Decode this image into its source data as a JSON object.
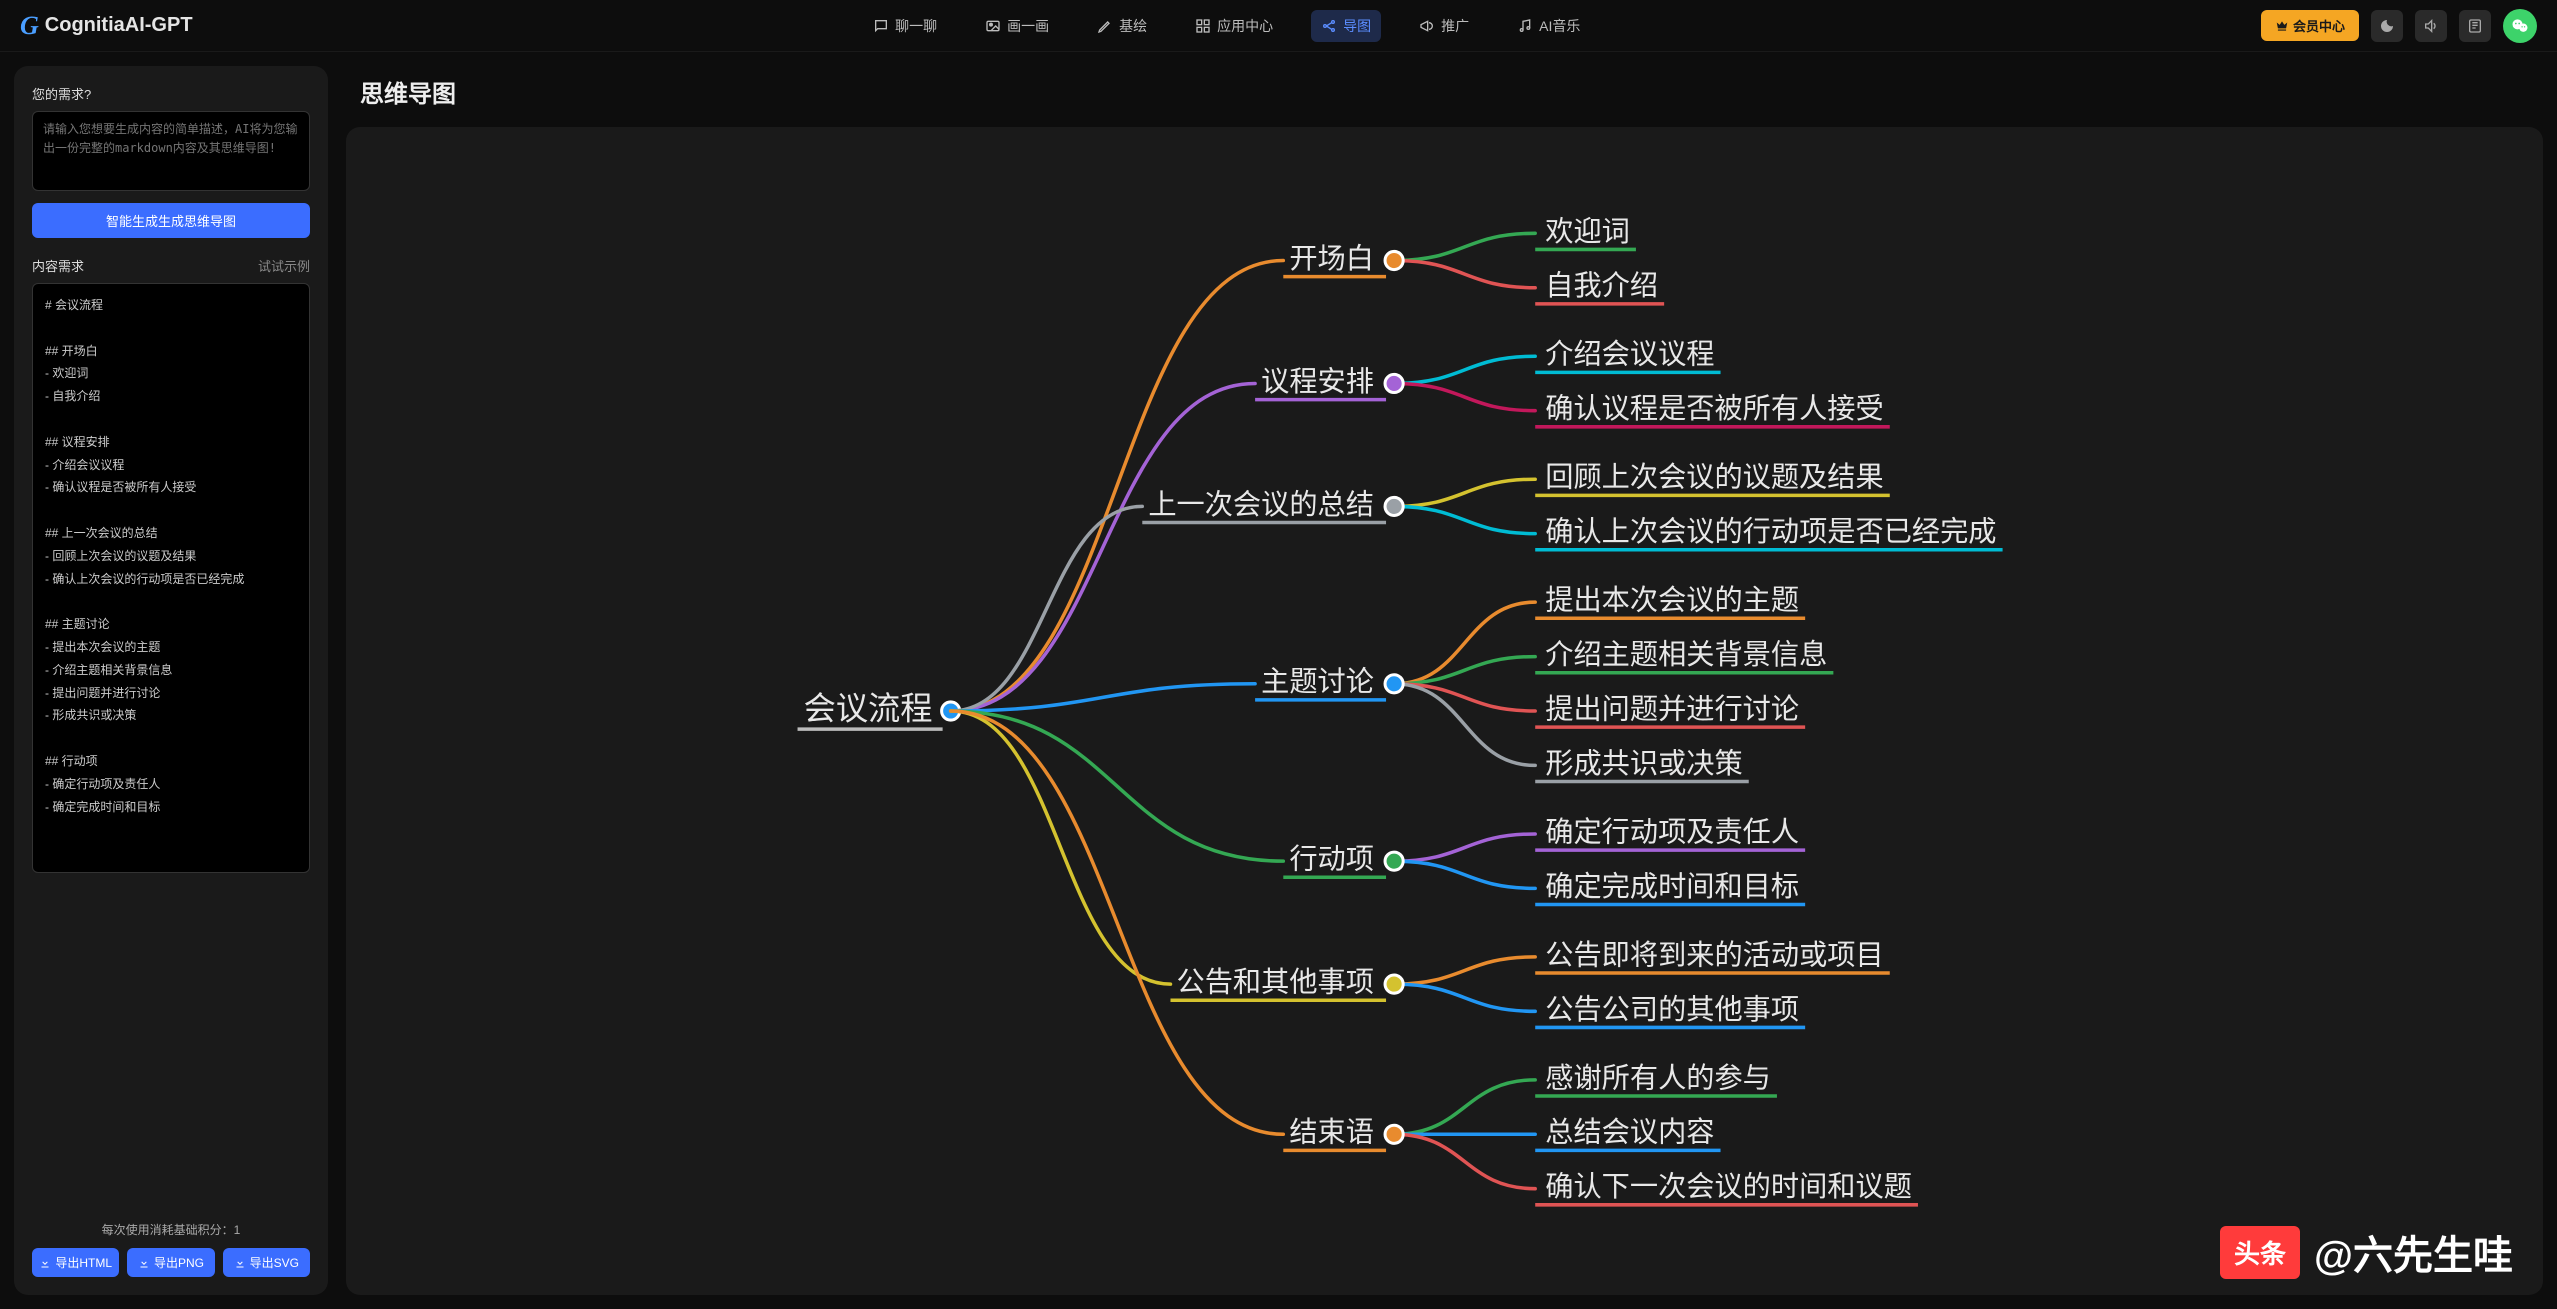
{
  "brand": "CognitiaAI-GPT",
  "nav": [
    {
      "icon": "chat",
      "label": "聊一聊"
    },
    {
      "icon": "image",
      "label": "画一画"
    },
    {
      "icon": "pen",
      "label": "基绘"
    },
    {
      "icon": "apps",
      "label": "应用中心"
    },
    {
      "icon": "mindmap",
      "label": "导图",
      "active": true
    },
    {
      "icon": "promo",
      "label": "推广"
    },
    {
      "icon": "music",
      "label": "AI音乐"
    }
  ],
  "header": {
    "vip": "会员中心"
  },
  "sidebar": {
    "requirement_label": "您的需求?",
    "placeholder": "请输入您想要生成内容的简单描述，AI将为您输出一份完整的markdown内容及其思维导图!",
    "gen_btn": "智能生成生成思维导图",
    "content_label": "内容需求",
    "example_hint": "试试示例",
    "markdown": "# 会议流程\n\n## 开场白\n- 欢迎词\n- 自我介绍\n\n## 议程安排\n- 介绍会议议程\n- 确认议程是否被所有人接受\n\n## 上一次会议的总结\n- 回顾上次会议的议题及结果\n- 确认上次会议的行动项是否已经完成\n\n## 主题讨论\n- 提出本次会议的主题\n- 介绍主题相关背景信息\n- 提出问题并进行讨论\n- 形成共识或决策\n\n## 行动项\n- 确定行动项及责任人\n- 确定完成时间和目标",
    "credits_label": "每次使用消耗基础积分：",
    "credits_value": "1",
    "export_html": "导出HTML",
    "export_png": "导出PNG",
    "export_svg": "导出SVG"
  },
  "main": {
    "title": "思维导图"
  },
  "mindmap": {
    "root": "会议流程",
    "colors": {
      "orange": "#e88b2e",
      "purple": "#a463d6",
      "gray": "#9aa0a6",
      "blue": "#2196f3",
      "green": "#34a853",
      "yellow": "#d4c22f",
      "red": "#e05454",
      "cyan": "#00bcd4",
      "magenta": "#c2185b"
    },
    "branches": [
      {
        "label": "开场白",
        "color": "orange",
        "leaves": [
          {
            "text": "欢迎词",
            "color": "green"
          },
          {
            "text": "自我介绍",
            "color": "red"
          }
        ]
      },
      {
        "label": "议程安排",
        "color": "purple",
        "leaves": [
          {
            "text": "介绍会议议程",
            "color": "cyan"
          },
          {
            "text": "确认议程是否被所有人接受",
            "color": "magenta"
          }
        ]
      },
      {
        "label": "上一次会议的总结",
        "color": "gray",
        "leaves": [
          {
            "text": "回顾上次会议的议题及结果",
            "color": "yellow"
          },
          {
            "text": "确认上次会议的行动项是否已经完成",
            "color": "cyan"
          }
        ]
      },
      {
        "label": "主题讨论",
        "color": "blue",
        "leaves": [
          {
            "text": "提出本次会议的主题",
            "color": "orange"
          },
          {
            "text": "介绍主题相关背景信息",
            "color": "green"
          },
          {
            "text": "提出问题并进行讨论",
            "color": "red"
          },
          {
            "text": "形成共识或决策",
            "color": "gray"
          }
        ]
      },
      {
        "label": "行动项",
        "color": "green",
        "leaves": [
          {
            "text": "确定行动项及责任人",
            "color": "purple"
          },
          {
            "text": "确定完成时间和目标",
            "color": "blue"
          }
        ]
      },
      {
        "label": "公告和其他事项",
        "color": "yellow",
        "leaves": [
          {
            "text": "公告即将到来的活动或项目",
            "color": "orange"
          },
          {
            "text": "公告公司的其他事项",
            "color": "blue"
          }
        ]
      },
      {
        "label": "结束语",
        "color": "orange",
        "leaves": [
          {
            "text": "感谢所有人的参与",
            "color": "green"
          },
          {
            "text": "总结会议内容",
            "color": "blue"
          },
          {
            "text": "确认下一次会议的时间和议题",
            "color": "red"
          }
        ]
      }
    ]
  },
  "watermark": {
    "logo": "头条",
    "text": "@六先生哇"
  }
}
